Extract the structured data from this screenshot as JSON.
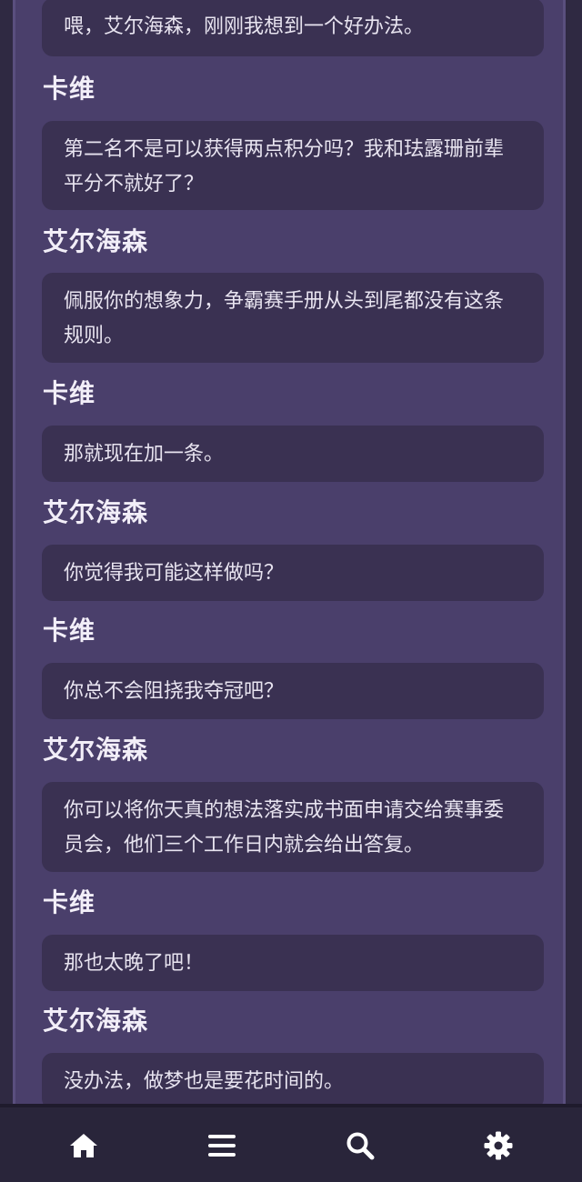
{
  "messages": [
    {
      "speaker": "",
      "text": "喂，艾尔海森，刚刚我想到一个好办法。"
    },
    {
      "speaker": "卡维",
      "text": "第二名不是可以获得两点积分吗？我和珐露珊前辈平分不就好了？"
    },
    {
      "speaker": "艾尔海森",
      "text": "佩服你的想象力，争霸赛手册从头到尾都没有这条规则。"
    },
    {
      "speaker": "卡维",
      "text": "那就现在加一条。"
    },
    {
      "speaker": "艾尔海森",
      "text": "你觉得我可能这样做吗？"
    },
    {
      "speaker": "卡维",
      "text": "你总不会阻挠我夺冠吧？"
    },
    {
      "speaker": "艾尔海森",
      "text": "你可以将你天真的想法落实成书面申请交给赛事委员会，他们三个工作日内就会给出答复。"
    },
    {
      "speaker": "卡维",
      "text": "那也太晚了吧！"
    },
    {
      "speaker": "艾尔海森",
      "text": "没办法，做梦也是要花时间的。"
    }
  ],
  "navbar": {
    "items": [
      {
        "icon": "home-icon"
      },
      {
        "icon": "menu-icon"
      },
      {
        "icon": "search-icon"
      },
      {
        "icon": "gear-icon"
      }
    ]
  },
  "colors": {
    "background": "#2f2942",
    "frame": "#4a3f6b",
    "bubble": "#3a3152",
    "navbar": "#29253a",
    "text": "#e8e4f0",
    "icon": "#ffffff"
  }
}
